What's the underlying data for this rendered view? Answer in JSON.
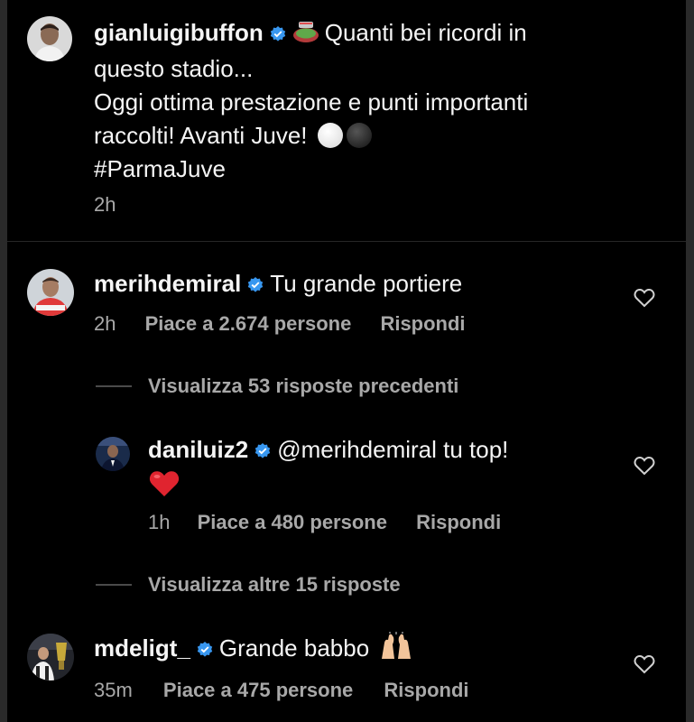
{
  "caption": {
    "username": "gianluigibuffon",
    "line1": "Quanti bei ricordi in",
    "line2": "questo stadio...",
    "line3": "Oggi ottima prestazione e punti importanti",
    "line4": "raccolti! Avanti Juve!",
    "hashtag": "#ParmaJuve",
    "time": "2h"
  },
  "comments": [
    {
      "username": "merihdemiral",
      "text": "Tu grande portiere",
      "time": "2h",
      "likes": "Piace a 2.674 persone",
      "reply_label": "Rispondi",
      "view_replies": "Visualizza 53 risposte precedenti"
    },
    {
      "username": "daniluiz2",
      "text": "@merihdemiral tu top!",
      "time": "1h",
      "likes": "Piace a 480 persone",
      "reply_label": "Rispondi",
      "view_more": "Visualizza altre 15 risposte"
    },
    {
      "username": "mdeligt_",
      "text": "Grande babbo",
      "time": "35m",
      "likes": "Piace a 475 persone",
      "reply_label": "Rispondi"
    }
  ],
  "colors": {
    "background": "#000000",
    "text": "#f5f5f5",
    "secondary": "#a8a8a8",
    "verified": "#3897f0"
  },
  "icons": [
    "verified-badge-icon",
    "stadium-emoji",
    "white-circle-emoji",
    "black-circle-emoji",
    "heart-outline-icon",
    "red-heart-emoji",
    "raised-hands-emoji"
  ]
}
